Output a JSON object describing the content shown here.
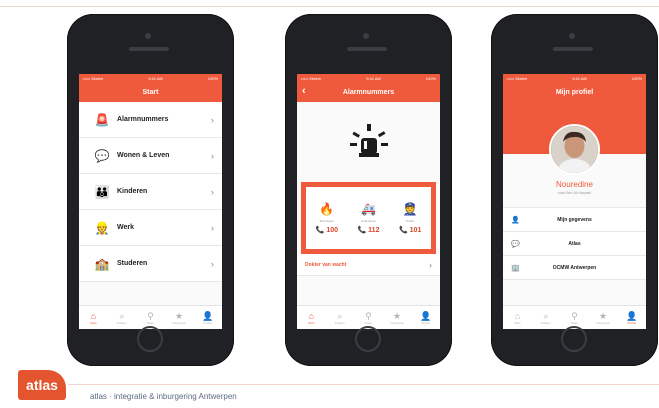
{
  "colors": {
    "accent": "#ef5a3c",
    "phone": "#1f2125",
    "text": "#222222"
  },
  "status": {
    "carrier": "••••• Sketch",
    "time": "9:41 AM",
    "battery": "100%"
  },
  "phone1": {
    "title": "Start",
    "items": [
      {
        "icon": "alarm-icon",
        "glyph": "🚨",
        "label": "Alarmnummers"
      },
      {
        "icon": "speech-bubble-icon",
        "glyph": "💬",
        "label": "Wonen & Leven"
      },
      {
        "icon": "family-icon",
        "glyph": "👪",
        "label": "Kinderen"
      },
      {
        "icon": "worker-icon",
        "glyph": "👷",
        "label": "Werk"
      },
      {
        "icon": "classroom-icon",
        "glyph": "🏫",
        "label": "Studeren"
      }
    ]
  },
  "phone2": {
    "title": "Alarmnummers",
    "back": "‹",
    "emergencies": [
      {
        "icon": "fire-icon",
        "glyph": "🔥",
        "label": "Brandweer",
        "number": "📞 100"
      },
      {
        "icon": "ambulance-icon",
        "glyph": "🚑",
        "label": "Ambulance",
        "number": "📞 112"
      },
      {
        "icon": "police-icon",
        "glyph": "👮",
        "label": "Politie",
        "number": "📞 101"
      }
    ],
    "doctor": "Dokter van wacht"
  },
  "phone3": {
    "title": "Mijn profiel",
    "name": "Nouredine",
    "sub": "zoek Ben-Ali Hassani",
    "rows": [
      {
        "icon": "person-icon",
        "glyph": "👤",
        "label": "Mijn gegevens"
      },
      {
        "icon": "chat-icon",
        "glyph": "💬",
        "label": "Atlas"
      },
      {
        "icon": "building-icon",
        "glyph": "🏢",
        "label": "OCMW Antwerpen"
      }
    ]
  },
  "tabs": [
    {
      "icon": "home-icon",
      "glyph": "⌂",
      "label": "Start"
    },
    {
      "icon": "search-icon",
      "glyph": "⌕",
      "label": "Zoeken"
    },
    {
      "icon": "map-pin-icon",
      "glyph": "⚲",
      "label": "Kaart"
    },
    {
      "icon": "star-icon",
      "glyph": "★",
      "label": "Favorieten"
    },
    {
      "icon": "profile-icon",
      "glyph": "👤",
      "label": "Profiel"
    }
  ],
  "footer": {
    "logo": "atlas",
    "text": "atlas · integratie & inburgering Antwerpen"
  }
}
